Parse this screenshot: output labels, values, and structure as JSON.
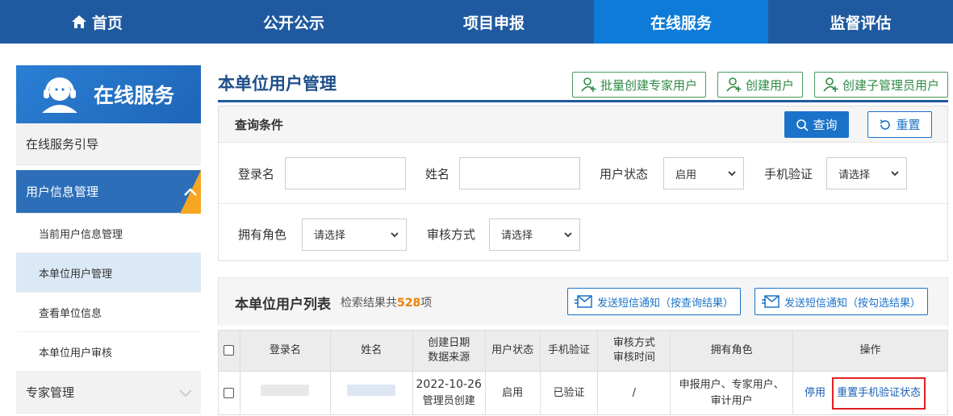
{
  "nav": {
    "items": [
      {
        "label": "首页"
      },
      {
        "label": "公开公示"
      },
      {
        "label": "项目申报"
      },
      {
        "label": "在线服务"
      },
      {
        "label": "监督评估"
      }
    ]
  },
  "sidebar": {
    "header": "在线服务",
    "guide": "在线服务引导",
    "group_active": "用户信息管理",
    "subitems": [
      "当前用户信息管理",
      "本单位用户管理",
      "查看单位信息",
      "本单位用户审核"
    ],
    "expert": "专家管理"
  },
  "main": {
    "title": "本单位用户管理",
    "btn_batch_expert": "批量创建专家用户",
    "btn_create_user": "创建用户",
    "btn_create_sub_admin": "创建子管理员用户"
  },
  "query": {
    "title": "查询条件",
    "btn_query": "查询",
    "btn_reset": "重置",
    "login_label": "登录名",
    "name_label": "姓名",
    "status_label": "用户状态",
    "status_value": "启用",
    "phone_label": "手机验证",
    "phone_value": "请选择",
    "role_label": "拥有角色",
    "role_value": "请选择",
    "audit_label": "审核方式",
    "audit_value": "请选择"
  },
  "list": {
    "title": "本单位用户列表",
    "count_prefix": "检索结果共",
    "count": "528",
    "count_suffix": "项",
    "btn_sms_query": "发送短信通知（按查询结果）",
    "btn_sms_checked": "发送短信通知（按勾选结果）"
  },
  "table": {
    "headers": {
      "login": "登录名",
      "name": "姓名",
      "created_1": "创建日期",
      "created_2": "数据来源",
      "status": "用户状态",
      "phone": "手机验证",
      "audit_1": "审核方式",
      "audit_2": "审核时间",
      "roles": "拥有角色",
      "ops": "操作"
    },
    "rows": [
      {
        "date": "2022-10-26",
        "source": "管理员创建",
        "status": "启用",
        "phone": "已验证",
        "audit": "/",
        "roles_1": "申报用户、专家用户、",
        "roles_2": "审计用户",
        "op_disable": "停用",
        "op_reset_phone": "重置手机验证状态"
      }
    ]
  },
  "colors": {
    "nav_bg": "#1f5aa0",
    "nav_active": "#0e7bd8",
    "accent_blue": "#1a73c9",
    "green": "#2e8b44",
    "count_orange": "#f08000",
    "highlight_red": "#e02020"
  }
}
